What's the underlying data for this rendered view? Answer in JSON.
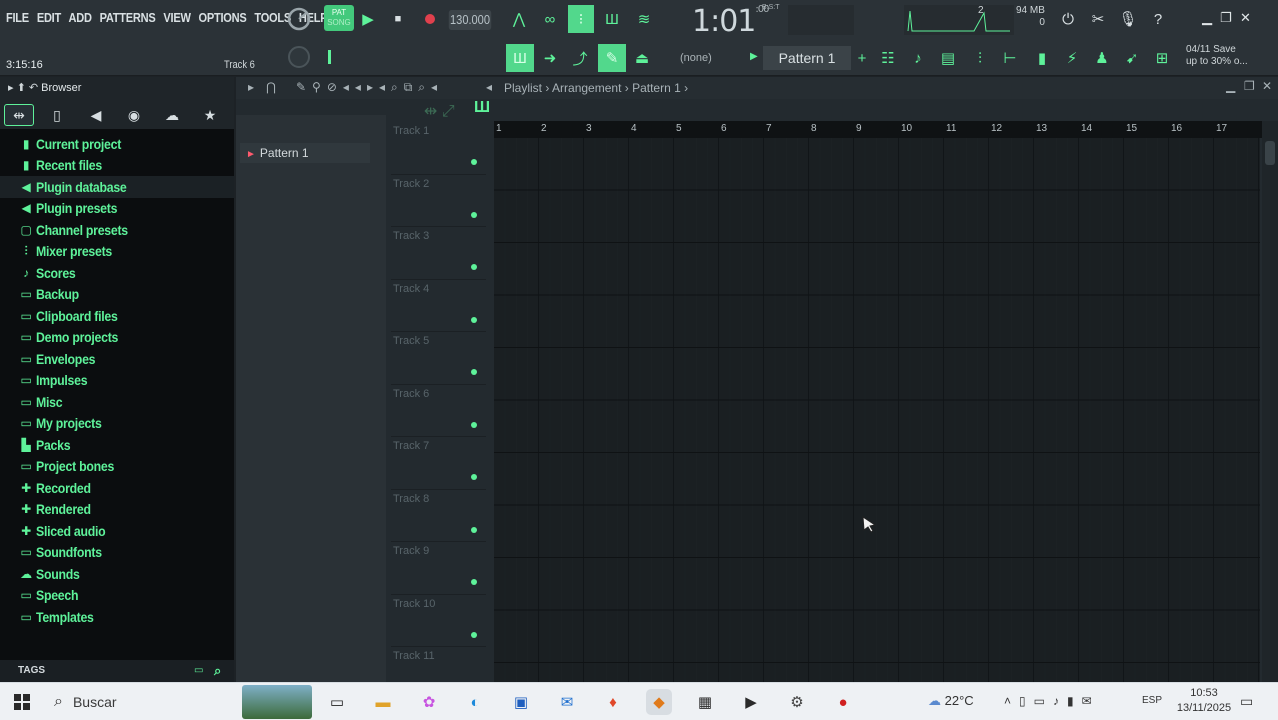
{
  "menu": [
    "FILE",
    "EDIT",
    "ADD",
    "PATTERNS",
    "VIEW",
    "OPTIONS",
    "TOOLS",
    "HELP"
  ],
  "transport": {
    "mode_label": "PAT",
    "mode_sub": "SONG",
    "tempo": "130.000",
    "song_time": "1:01",
    "song_time_sub": ":00",
    "time_unit": "B:S:T"
  },
  "status": {
    "clock": "3:15:16",
    "hint_track": "Track 6",
    "pattern_selector": "(none)",
    "current_pattern": "Pattern 1",
    "memory": "94 MB",
    "memory_sub": "0",
    "cpu_top": "2",
    "hint_right_date": "04/11",
    "hint_right_title": "Save",
    "hint_right_text": "up to 30% o..."
  },
  "browser": {
    "title": "Browser",
    "items": [
      {
        "label": "Current project",
        "icon": "document-icon"
      },
      {
        "label": "Recent files",
        "icon": "document-icon"
      },
      {
        "label": "Plugin database",
        "icon": "plugin-icon"
      },
      {
        "label": "Plugin presets",
        "icon": "plugin-icon"
      },
      {
        "label": "Channel presets",
        "icon": "channel-icon"
      },
      {
        "label": "Mixer presets",
        "icon": "mixer-icon"
      },
      {
        "label": "Scores",
        "icon": "note-icon"
      },
      {
        "label": "Backup",
        "icon": "folder-icon"
      },
      {
        "label": "Clipboard files",
        "icon": "folder-icon"
      },
      {
        "label": "Demo projects",
        "icon": "folder-icon"
      },
      {
        "label": "Envelopes",
        "icon": "folder-icon"
      },
      {
        "label": "Impulses",
        "icon": "folder-icon"
      },
      {
        "label": "Misc",
        "icon": "folder-icon"
      },
      {
        "label": "My projects",
        "icon": "folder-icon"
      },
      {
        "label": "Packs",
        "icon": "packs-icon"
      },
      {
        "label": "Project bones",
        "icon": "folder-icon"
      },
      {
        "label": "Recorded",
        "icon": "plus-icon"
      },
      {
        "label": "Rendered",
        "icon": "plus-icon"
      },
      {
        "label": "Sliced audio",
        "icon": "plus-icon"
      },
      {
        "label": "Soundfonts",
        "icon": "folder-icon"
      },
      {
        "label": "Sounds",
        "icon": "cloud-icon"
      },
      {
        "label": "Speech",
        "icon": "folder-icon"
      },
      {
        "label": "Templates",
        "icon": "folder-icon"
      }
    ],
    "tags_label": "TAGS"
  },
  "playlist": {
    "breadcrumb": [
      "Playlist",
      "Arrangement",
      "Pattern 1"
    ],
    "patterns": [
      "Pattern 1"
    ],
    "tracks": [
      "Track 1",
      "Track 2",
      "Track 3",
      "Track 4",
      "Track 5",
      "Track 6",
      "Track 7",
      "Track 8",
      "Track 9",
      "Track 10",
      "Track 11"
    ],
    "bars": [
      "1",
      "2",
      "3",
      "4",
      "5",
      "6",
      "7",
      "8",
      "9",
      "10",
      "11",
      "12",
      "13",
      "14",
      "15",
      "16",
      "17"
    ]
  },
  "taskbar": {
    "search_placeholder": "Buscar",
    "weather": "22°C",
    "language": "ESP",
    "time": "10:53",
    "date": "13/11/2025"
  },
  "colors": {
    "accent": "#5ef29a",
    "panel": "#2b3237",
    "browser_bg": "#0b0d0f",
    "grid_bg": "#1a1f22",
    "record": "#e0404d"
  }
}
